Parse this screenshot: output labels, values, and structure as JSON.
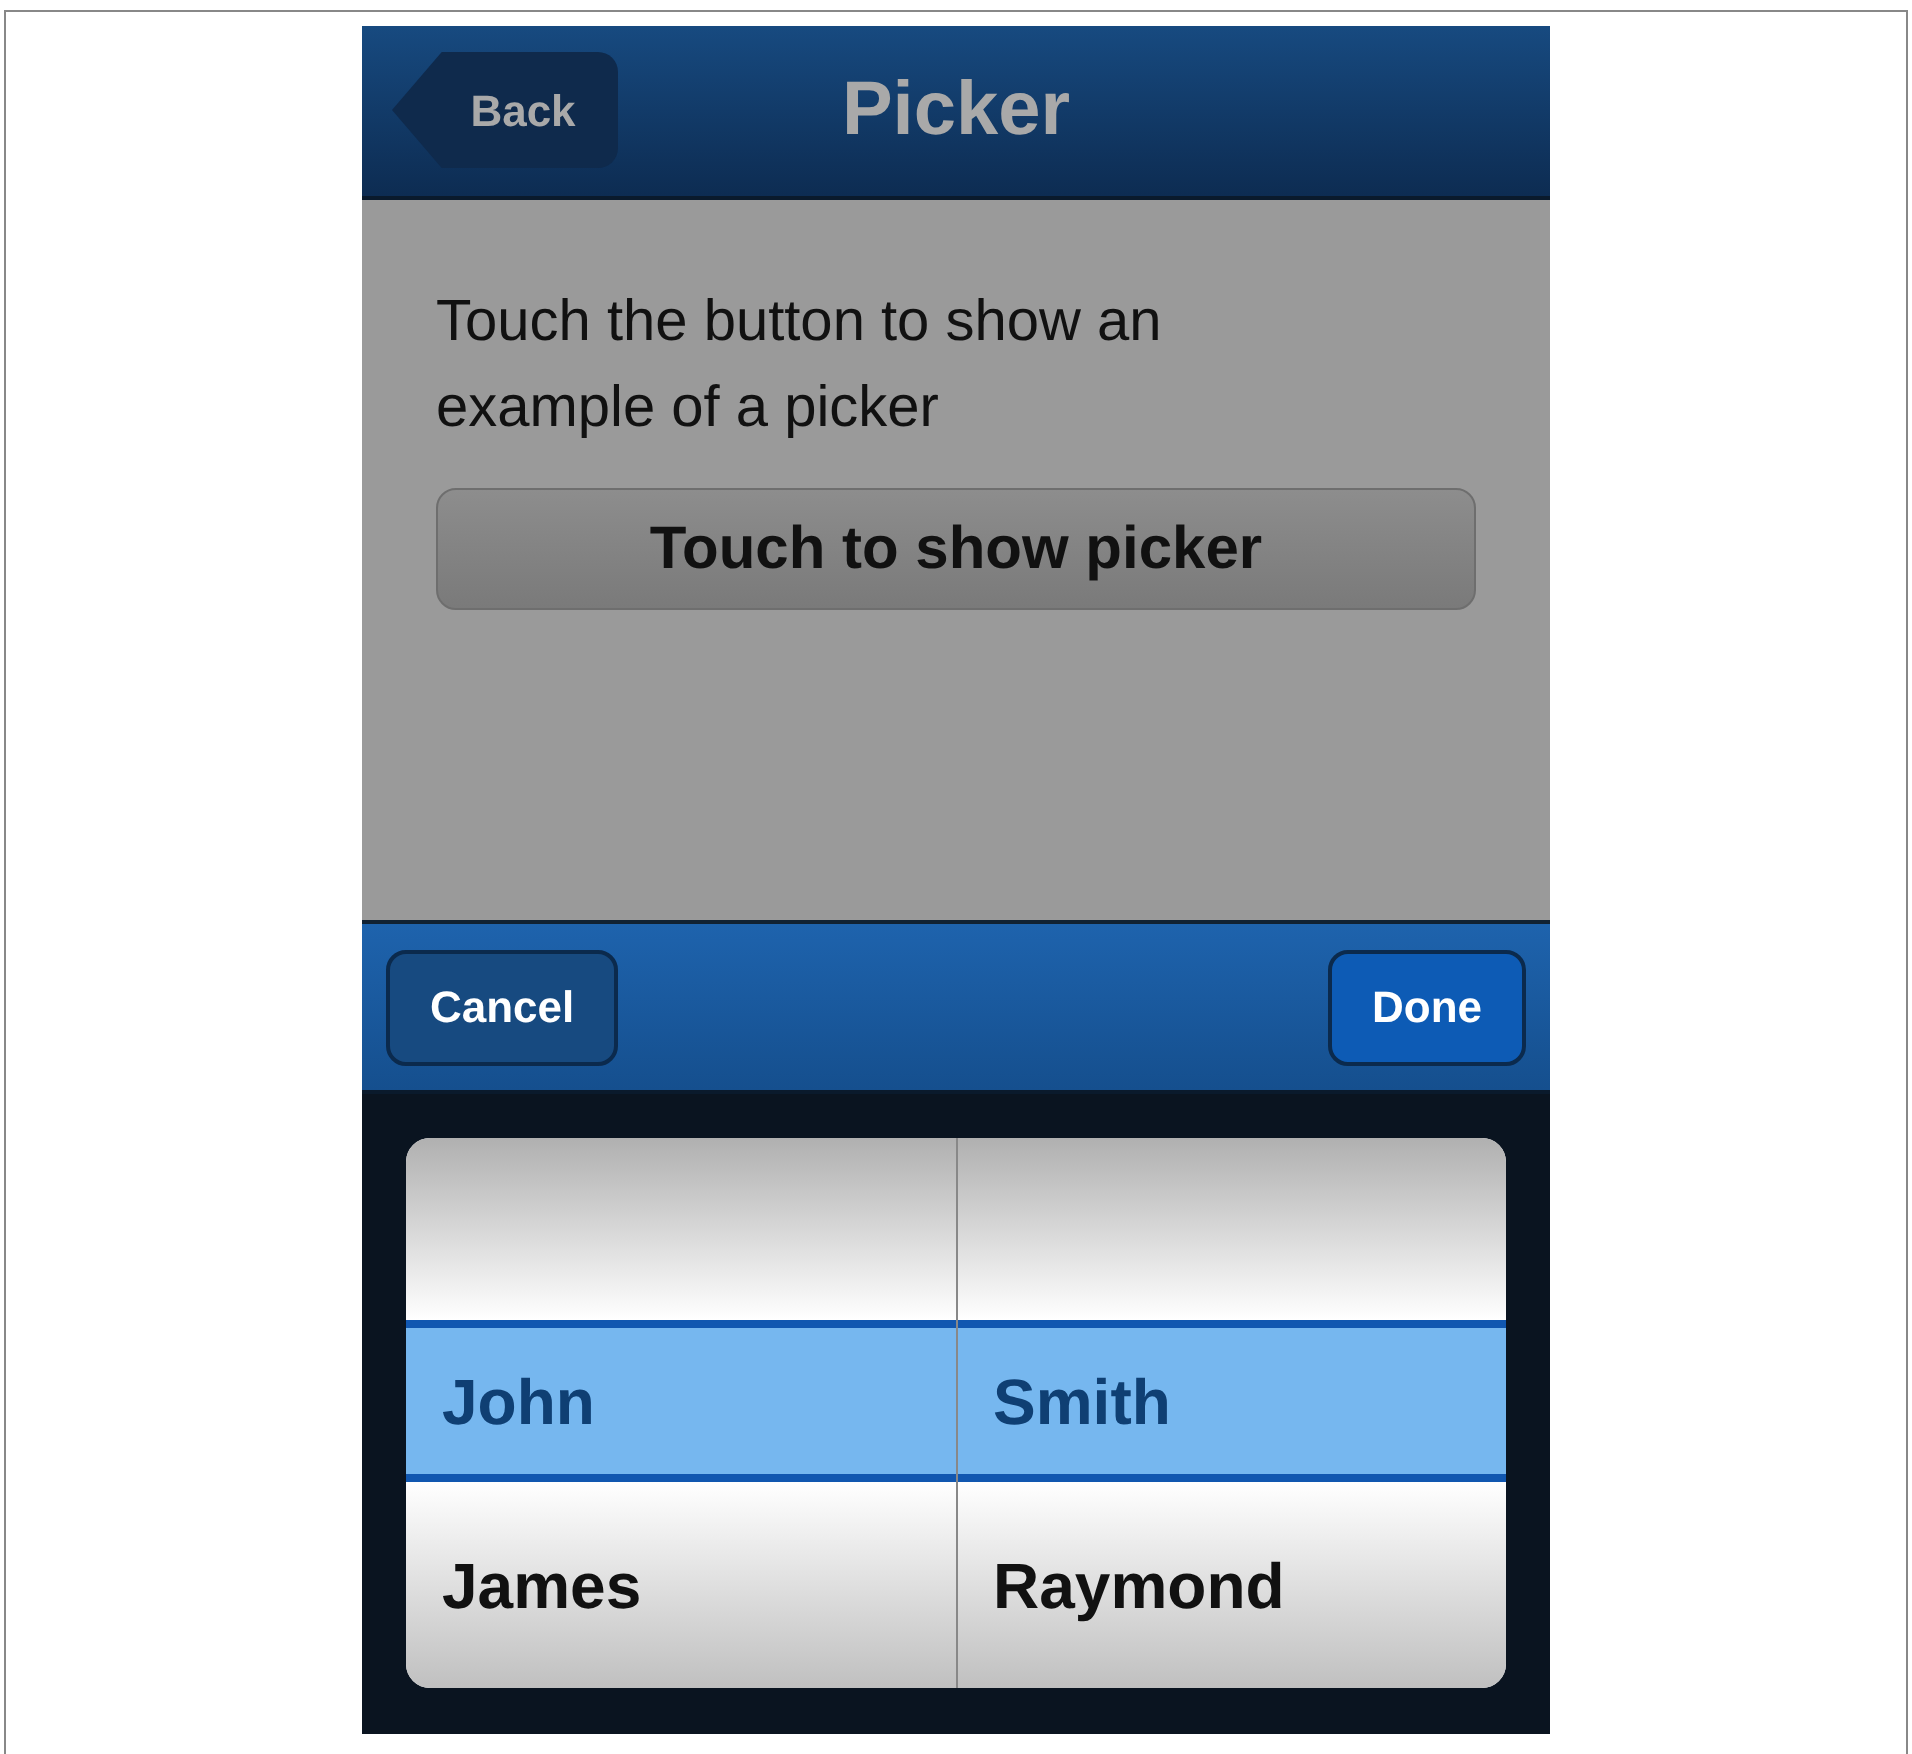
{
  "nav_bar": {
    "back_button": "Back",
    "title": "Picker"
  },
  "content": {
    "instruction": "Touch the button to show an example of a picker",
    "button": "Touch to show picker"
  },
  "toolbar": {
    "cancel_button": "Cancel",
    "done_button": "Done"
  },
  "picker": {
    "columns": [
      {
        "rows": [
          {
            "label": "John",
            "selected": true
          },
          {
            "label": "James",
            "selected": false
          }
        ]
      },
      {
        "rows": [
          {
            "label": "Smith",
            "selected": true
          },
          {
            "label": "Raymond",
            "selected": false
          }
        ]
      }
    ]
  }
}
